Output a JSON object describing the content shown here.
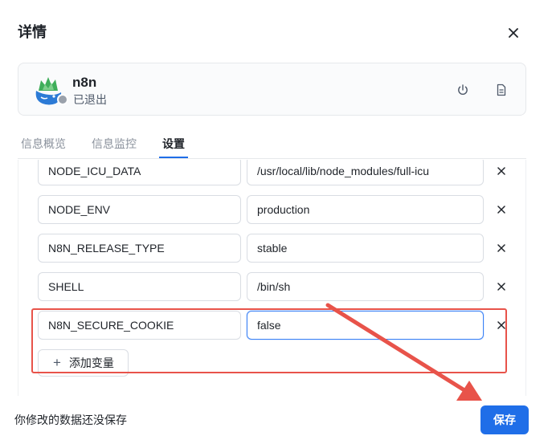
{
  "dialog": {
    "title": "详情"
  },
  "app": {
    "name": "n8n",
    "status": "已退出",
    "status_color": "#9aa1ab"
  },
  "tabs": [
    {
      "label": "信息概览",
      "active": false
    },
    {
      "label": "信息监控",
      "active": false
    },
    {
      "label": "设置",
      "active": true
    }
  ],
  "env_vars": [
    {
      "key": "NODE_ICU_DATA",
      "value": "/usr/local/lib/node_modules/full-icu"
    },
    {
      "key": "NODE_ENV",
      "value": "production"
    },
    {
      "key": "N8N_RELEASE_TYPE",
      "value": "stable"
    },
    {
      "key": "SHELL",
      "value": "/bin/sh"
    },
    {
      "key": "N8N_SECURE_COOKIE",
      "value": "false"
    }
  ],
  "add_variable_label": "添加变量",
  "footer": {
    "unsaved_hint": "你修改的数据还没保存",
    "save_label": "保存"
  },
  "colors": {
    "accent": "#1f6ee8",
    "annotation": "#e8534a"
  }
}
